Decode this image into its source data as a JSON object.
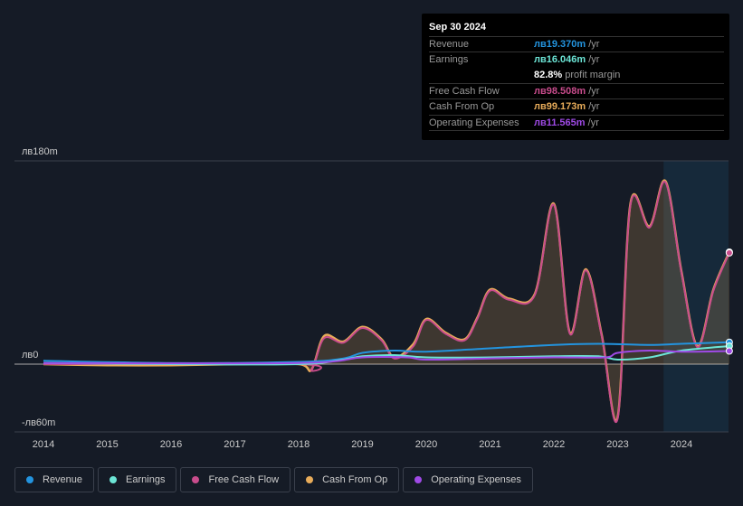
{
  "tooltip": {
    "date": "Sep 30 2024",
    "rows": [
      {
        "label": "Revenue",
        "value": "лв19.370m",
        "unit": " /yr",
        "color": "#2394df"
      },
      {
        "label": "Earnings",
        "value": "лв16.046m",
        "unit": " /yr",
        "color": "#6ce5d6"
      },
      {
        "label": "",
        "value": "82.8%",
        "unit": " profit margin",
        "color": "#ffffff"
      },
      {
        "label": "Free Cash Flow",
        "value": "лв98.508m",
        "unit": " /yr",
        "color": "#c84c8c"
      },
      {
        "label": "Cash From Op",
        "value": "лв99.173m",
        "unit": " /yr",
        "color": "#e8ac5a"
      },
      {
        "label": "Operating Expenses",
        "value": "лв11.565m",
        "unit": " /yr",
        "color": "#9f4ae6"
      }
    ]
  },
  "legend": [
    {
      "label": "Revenue",
      "color": "#2394df"
    },
    {
      "label": "Earnings",
      "color": "#6ce5d6"
    },
    {
      "label": "Free Cash Flow",
      "color": "#c84c8c"
    },
    {
      "label": "Cash From Op",
      "color": "#e8ac5a"
    },
    {
      "label": "Operating Expenses",
      "color": "#9f4ae6"
    }
  ],
  "chart_data": {
    "type": "line",
    "ylim": [
      -60,
      180
    ],
    "yticks": [
      {
        "v": 180,
        "label": "лв180m"
      },
      {
        "v": 0,
        "label": "лв0"
      },
      {
        "v": -60,
        "label": "-лв60m"
      }
    ],
    "xticks": [
      "2014",
      "2015",
      "2016",
      "2017",
      "2018",
      "2019",
      "2020",
      "2021",
      "2022",
      "2023",
      "2024"
    ],
    "xlim": [
      2014,
      2024.75
    ],
    "grid": true,
    "series": [
      {
        "name": "Cash From Op",
        "color": "#e8ac5a",
        "area": true,
        "points": [
          [
            2014,
            0
          ],
          [
            2015,
            -1
          ],
          [
            2016,
            -1
          ],
          [
            2017,
            0
          ],
          [
            2018,
            0
          ],
          [
            2018.2,
            -5
          ],
          [
            2018.4,
            25
          ],
          [
            2018.7,
            20
          ],
          [
            2019,
            33
          ],
          [
            2019.3,
            22
          ],
          [
            2019.5,
            6
          ],
          [
            2019.8,
            18
          ],
          [
            2020,
            40
          ],
          [
            2020.3,
            28
          ],
          [
            2020.6,
            22
          ],
          [
            2020.8,
            41
          ],
          [
            2021,
            66
          ],
          [
            2021.3,
            58
          ],
          [
            2021.7,
            62
          ],
          [
            2022,
            142
          ],
          [
            2022.25,
            28
          ],
          [
            2022.5,
            84
          ],
          [
            2022.75,
            26
          ],
          [
            2023,
            -47
          ],
          [
            2023.2,
            142
          ],
          [
            2023.5,
            122
          ],
          [
            2023.75,
            162
          ],
          [
            2024,
            82
          ],
          [
            2024.25,
            16
          ],
          [
            2024.5,
            66
          ],
          [
            2024.75,
            99.2
          ]
        ]
      },
      {
        "name": "Free Cash Flow",
        "color": "#c84c8c",
        "area": false,
        "points": [
          [
            2014,
            0
          ],
          [
            2018,
            0
          ],
          [
            2018.2,
            -5
          ],
          [
            2018.4,
            23
          ],
          [
            2018.7,
            19
          ],
          [
            2019,
            32
          ],
          [
            2019.3,
            21
          ],
          [
            2019.5,
            5
          ],
          [
            2019.8,
            16
          ],
          [
            2020,
            39
          ],
          [
            2020.3,
            27
          ],
          [
            2020.6,
            21
          ],
          [
            2020.8,
            40
          ],
          [
            2021,
            65
          ],
          [
            2021.3,
            57
          ],
          [
            2021.7,
            61
          ],
          [
            2022,
            141
          ],
          [
            2022.25,
            27
          ],
          [
            2022.5,
            83
          ],
          [
            2022.75,
            25
          ],
          [
            2023,
            -48
          ],
          [
            2023.2,
            141
          ],
          [
            2023.5,
            121
          ],
          [
            2023.75,
            161
          ],
          [
            2024,
            81
          ],
          [
            2024.25,
            15
          ],
          [
            2024.5,
            65
          ],
          [
            2024.75,
            98.5
          ]
        ]
      },
      {
        "name": "Revenue",
        "color": "#2394df",
        "area": false,
        "points": [
          [
            2014,
            3
          ],
          [
            2016,
            1
          ],
          [
            2018,
            2
          ],
          [
            2018.7,
            5
          ],
          [
            2019,
            10
          ],
          [
            2019.5,
            12
          ],
          [
            2020,
            11
          ],
          [
            2021,
            14
          ],
          [
            2022,
            17
          ],
          [
            2022.7,
            18
          ],
          [
            2023.5,
            17
          ],
          [
            2024,
            18
          ],
          [
            2024.75,
            19.4
          ]
        ]
      },
      {
        "name": "Earnings",
        "color": "#6ce5d6",
        "area": false,
        "points": [
          [
            2014,
            1
          ],
          [
            2016,
            0
          ],
          [
            2018,
            0
          ],
          [
            2018.7,
            4
          ],
          [
            2019,
            7
          ],
          [
            2019.5,
            8
          ],
          [
            2020,
            6
          ],
          [
            2021,
            6
          ],
          [
            2022,
            7
          ],
          [
            2022.7,
            7
          ],
          [
            2023,
            4
          ],
          [
            2023.5,
            6
          ],
          [
            2024,
            12
          ],
          [
            2024.75,
            16.0
          ]
        ]
      },
      {
        "name": "Operating Expenses",
        "color": "#9f4ae6",
        "area": false,
        "points": [
          [
            2014,
            1
          ],
          [
            2018,
            1
          ],
          [
            2019,
            6
          ],
          [
            2019.7,
            6
          ],
          [
            2020,
            4
          ],
          [
            2021,
            5
          ],
          [
            2022,
            6
          ],
          [
            2022.8,
            6
          ],
          [
            2023,
            10
          ],
          [
            2023.5,
            12
          ],
          [
            2024,
            11
          ],
          [
            2024.75,
            11.6
          ]
        ]
      }
    ]
  }
}
